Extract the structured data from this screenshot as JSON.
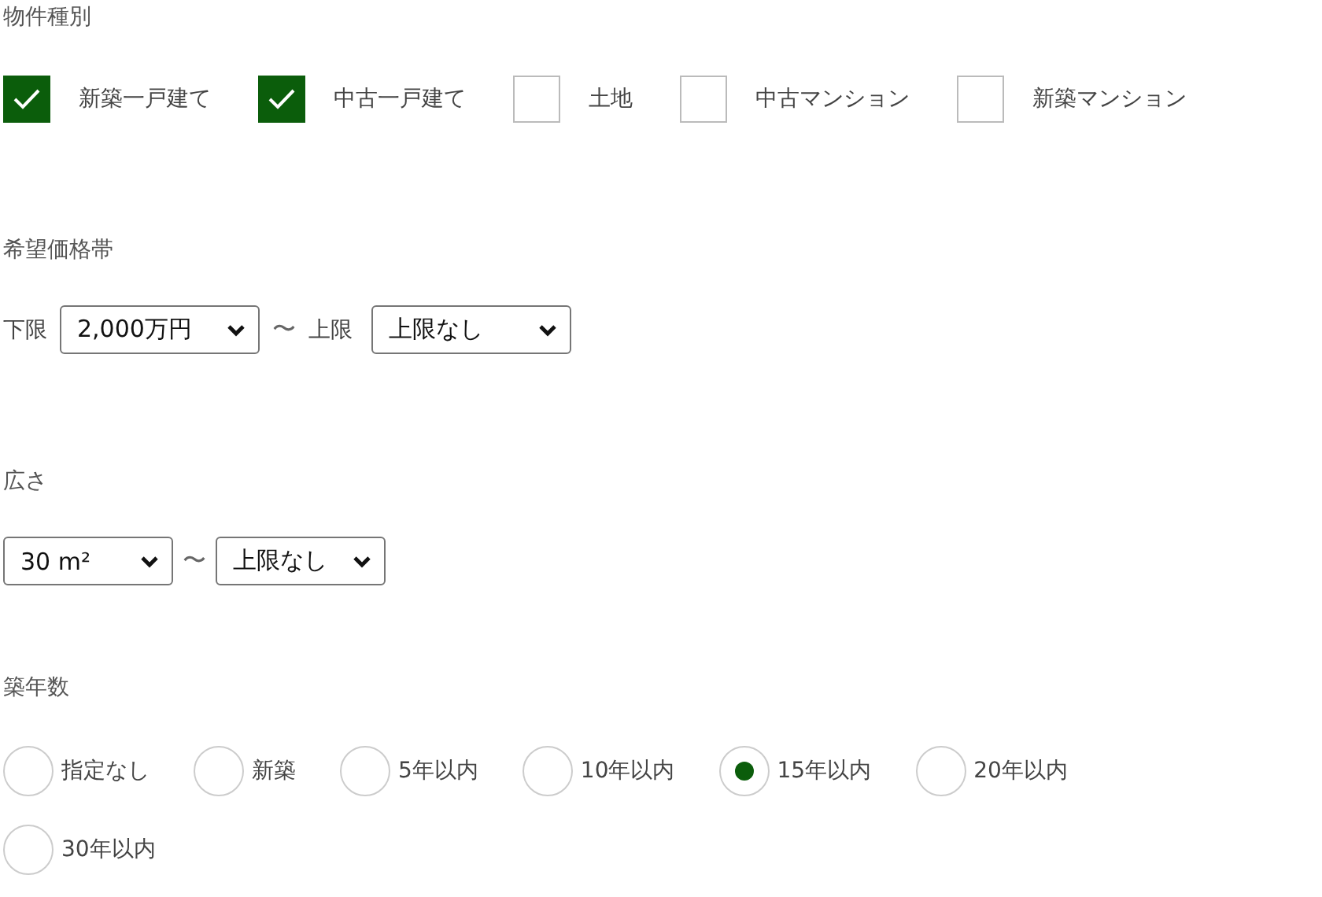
{
  "property_type": {
    "heading": "物件種別",
    "options": [
      {
        "label": "新築一戸建て",
        "checked": true
      },
      {
        "label": "中古一戸建て",
        "checked": true
      },
      {
        "label": "土地",
        "checked": false
      },
      {
        "label": "中古マンション",
        "checked": false
      },
      {
        "label": "新築マンション",
        "checked": false
      }
    ]
  },
  "price_range": {
    "heading": "希望価格帯",
    "lower_label": "下限",
    "lower_value": "2,000万円",
    "separator": "〜",
    "upper_label": "上限",
    "upper_value": "上限なし"
  },
  "area": {
    "heading": "広さ",
    "lower_value": "30 m²",
    "separator": "〜",
    "upper_value": "上限なし"
  },
  "building_age": {
    "heading": "築年数",
    "options": [
      {
        "label": "指定なし",
        "selected": false
      },
      {
        "label": "新築",
        "selected": false
      },
      {
        "label": "5年以内",
        "selected": false
      },
      {
        "label": "10年以内",
        "selected": false
      },
      {
        "label": "15年以内",
        "selected": true
      },
      {
        "label": "20年以内",
        "selected": false
      },
      {
        "label": "30年以内",
        "selected": false
      }
    ]
  }
}
